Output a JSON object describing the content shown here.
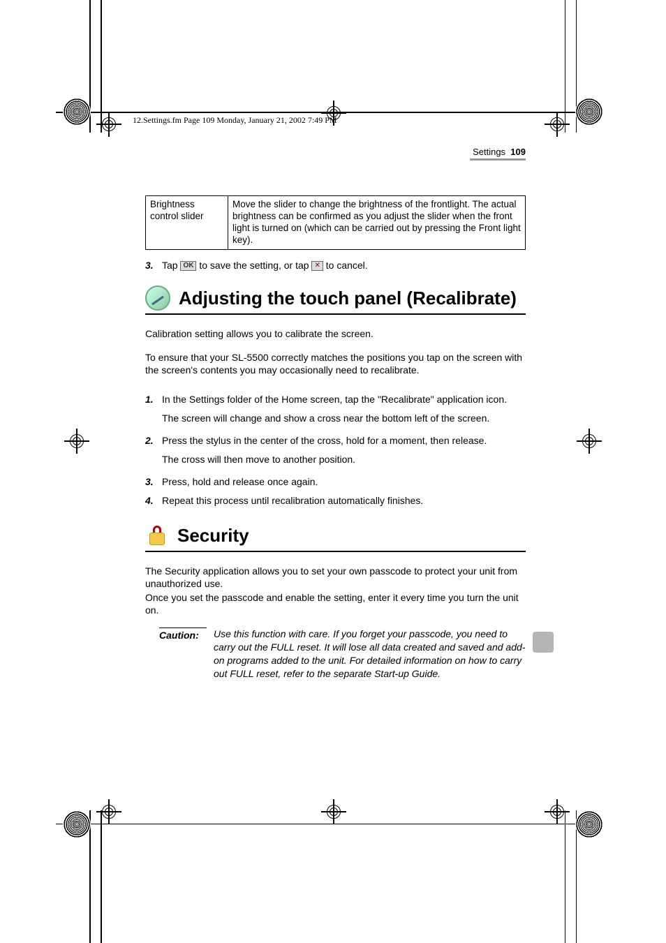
{
  "header": {
    "info": "12.Settings.fm  Page 109  Monday, January 21, 2002  7:49 PM"
  },
  "runningHead": {
    "section": "Settings",
    "page": "109"
  },
  "table": {
    "label": "Brightness control slider",
    "desc": "Move the slider to change the brightness of the frontlight. The actual brightness can be confirmed as you adjust the slider when the front light is turned on (which can be carried out by pressing the Front light key)."
  },
  "prestep": {
    "num": "3.",
    "before": "Tap ",
    "ok": "OK",
    "mid": " to save the setting, or tap ",
    "x": "✕",
    "after": " to cancel."
  },
  "section1": {
    "title": "Adjusting the touch panel (Recalibrate)",
    "para1": "Calibration setting allows you to calibrate the screen.",
    "para2": "To ensure that your SL-5500 correctly matches the positions you tap on the screen with the screen's contents you may occasionally need to recalibrate.",
    "steps": [
      {
        "num": "1.",
        "text": "In the Settings folder of the Home screen, tap the \"Recalibrate\" application icon.",
        "sub": "The screen will change and show a cross near the bottom left of the screen."
      },
      {
        "num": "2.",
        "text": "Press the stylus in the center of the cross, hold for a moment, then release.",
        "sub": "The cross will then move to another position."
      },
      {
        "num": "3.",
        "text": "Press, hold and release once again.",
        "sub": ""
      },
      {
        "num": "4.",
        "text": "Repeat this process until recalibration automatically finishes.",
        "sub": ""
      }
    ]
  },
  "section2": {
    "title": "Security",
    "para1": "The Security application allows you to set your own passcode to protect your unit from unauthorized use.",
    "para2": "Once you set the passcode and enable the setting, enter it every time you turn the unit on.",
    "cautionLabel": "Caution:",
    "cautionText": "Use this function with care. If you forget your passcode, you need to carry out the FULL reset. It will lose all data created and saved and add-on programs added to the unit. For detailed information on how to carry out FULL reset, refer to the separate Start-up Guide."
  }
}
